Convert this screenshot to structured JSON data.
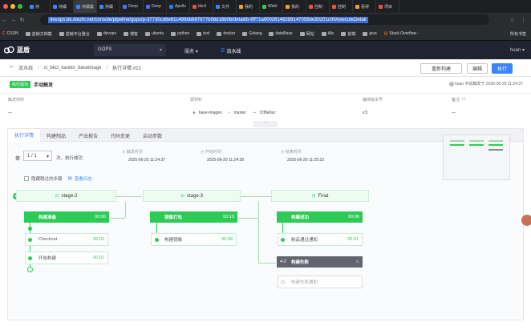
{
  "browser": {
    "tabs": [
      {
        "label": "持"
      },
      {
        "label": "持續"
      },
      {
        "label": "持續集"
      },
      {
        "label": "持續"
      },
      {
        "label": "Deep"
      },
      {
        "label": "Deep"
      },
      {
        "label": "Apollo"
      },
      {
        "label": "bkcil"
      },
      {
        "label": "文件"
      },
      {
        "label": "我的"
      },
      {
        "label": "WebI"
      },
      {
        "label": "我的"
      },
      {
        "label": "控制"
      },
      {
        "label": "控制"
      },
      {
        "label": "看得"
      },
      {
        "label": "项目"
      }
    ],
    "url": "devops.bk.diezhi.net/console/pipeline/gops/p-37730cd8e61c498bb687877b56d16b0b/detail/b-6ff71a00026148289147059de30201c00/executeDetail",
    "bookmarks": [
      {
        "label": "CSDN"
      },
      {
        "label": "蓝鲸文档集"
      },
      {
        "label": "蓝鲸平台整合"
      },
      {
        "label": "devops"
      },
      {
        "label": "博客"
      },
      {
        "label": "ubuntu"
      },
      {
        "label": "python"
      },
      {
        "label": "tool"
      },
      {
        "label": "docker"
      },
      {
        "label": "Golang"
      },
      {
        "label": "dataBase"
      },
      {
        "label": "网站"
      },
      {
        "label": "k8s"
      },
      {
        "label": "前端"
      },
      {
        "label": "java"
      },
      {
        "label": "Stack Overflow -"
      }
    ],
    "bookmarks_more": "所有书签"
  },
  "topnav": {
    "logo": "蓝盾",
    "project": "GOPS",
    "services": "服务",
    "pipeline": "流水线",
    "user": "huan"
  },
  "breadcrumb": {
    "root": "流水线",
    "pipeline": "ci_bkci_kaniko_baseimage",
    "detail": "执行详情 #22"
  },
  "actions": {
    "rebuild": "重新构建",
    "edit": "编辑",
    "execute": "执行"
  },
  "status": {
    "badge": "执行成功",
    "trigger": "手动触发",
    "trigger_info": "huan 手动触发于 2025-06-20 11:24:37"
  },
  "meta": {
    "material_label": "触发材料",
    "material_value": "—",
    "source_label": "源材料",
    "repo": "base-images",
    "branch": "master",
    "commit": "72f8e0ac",
    "version_label": "编排版本号",
    "version_value": "v.5",
    "remark_label": "备注",
    "remark_value": "—"
  },
  "tabs": [
    {
      "label": "执行详情"
    },
    {
      "label": "构建制品"
    },
    {
      "label": "产出报告"
    },
    {
      "label": "代码变更"
    },
    {
      "label": "启动参数"
    }
  ],
  "exec": {
    "prefix": "第",
    "select": "1 / 1",
    "suffix": "次，执行成功",
    "queue_label": "触发时间",
    "queue_time": "2025-06-20 11:24:37",
    "start_label": "开始时间",
    "start_time": "2025-06-20 11:24:39",
    "end_label": "结束时间",
    "end_time": "2025-06-20 11:25:23",
    "skip_label": "隐藏跳过的步骤",
    "log_label": "查看日志"
  },
  "stages": [
    {
      "name": "stage-2",
      "job": "构建准备",
      "job_time": "00:06",
      "elements": [
        {
          "name": "Checkout",
          "time": "00:02"
        },
        {
          "name": "开始构建",
          "time": "00:01"
        }
      ]
    },
    {
      "name": "stage-3",
      "job": "镜像打包",
      "job_time": "00:15",
      "elements": [
        {
          "name": "构建镜像",
          "time": "00:08"
        }
      ]
    },
    {
      "name": "Final",
      "job": "构建成功",
      "job_time": "00:06",
      "elements": [
        {
          "name": "制品通过通知",
          "time": "00:01"
        }
      ],
      "fail_job_index": "4-2",
      "fail_job": "构建失败",
      "fail_element": "构建失败通知"
    }
  ],
  "colors": {
    "success": "#2dcb56",
    "primary": "#3a84ff",
    "nav": "#1f2430",
    "fail": "#63656e"
  }
}
